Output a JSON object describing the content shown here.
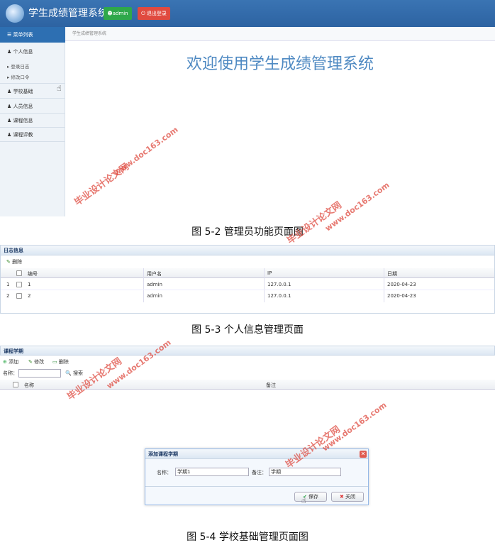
{
  "fig1": {
    "app_title": "学生成绩管理系统",
    "user_button": "admin",
    "logout_button": "退出登录",
    "menu_header": "菜单列表",
    "menu": [
      "个人信息",
      "学校基础",
      "人员信息",
      "课程信息",
      "课程评教"
    ],
    "submenu": [
      "登录日志",
      "修改口令"
    ],
    "breadcrumb": "学生成绩管理系统",
    "welcome": "欢迎使用学生成绩管理系统",
    "caption": "图 5-2 管理员功能页面图"
  },
  "fig2": {
    "panel_title": "日志信息",
    "delete_label": "删除",
    "columns": [
      "编号",
      "用户名",
      "IP",
      "日期"
    ],
    "rows": [
      {
        "n": "1",
        "id": "1",
        "user": "admin",
        "ip": "127.0.0.1",
        "date": "2020-04-23"
      },
      {
        "n": "2",
        "id": "2",
        "user": "admin",
        "ip": "127.0.0.1",
        "date": "2020-04-23"
      }
    ],
    "caption": "图 5-3 个人信息管理页面"
  },
  "fig3": {
    "panel_title": "课程学期",
    "add_label": "添加",
    "edit_label": "修改",
    "delete_label": "删除",
    "name_label": "名称：",
    "search_label": "搜索",
    "columns": [
      "名称",
      "备注"
    ],
    "dialog": {
      "title": "添加课程学期",
      "name_label": "名称：",
      "name_value": "学期1",
      "remark_label": "备注：",
      "remark_value": "学期",
      "save_label": "保存",
      "close_label": "关闭"
    },
    "caption": "图 5-4 学校基础管理页面图"
  },
  "watermark": {
    "line1": "毕业设计论文网",
    "line2": "www.doc163.com"
  },
  "colors": {
    "header_blue": "#2d63a2",
    "welcome_blue": "#4e89c2",
    "watermark_red": "#de463c"
  }
}
